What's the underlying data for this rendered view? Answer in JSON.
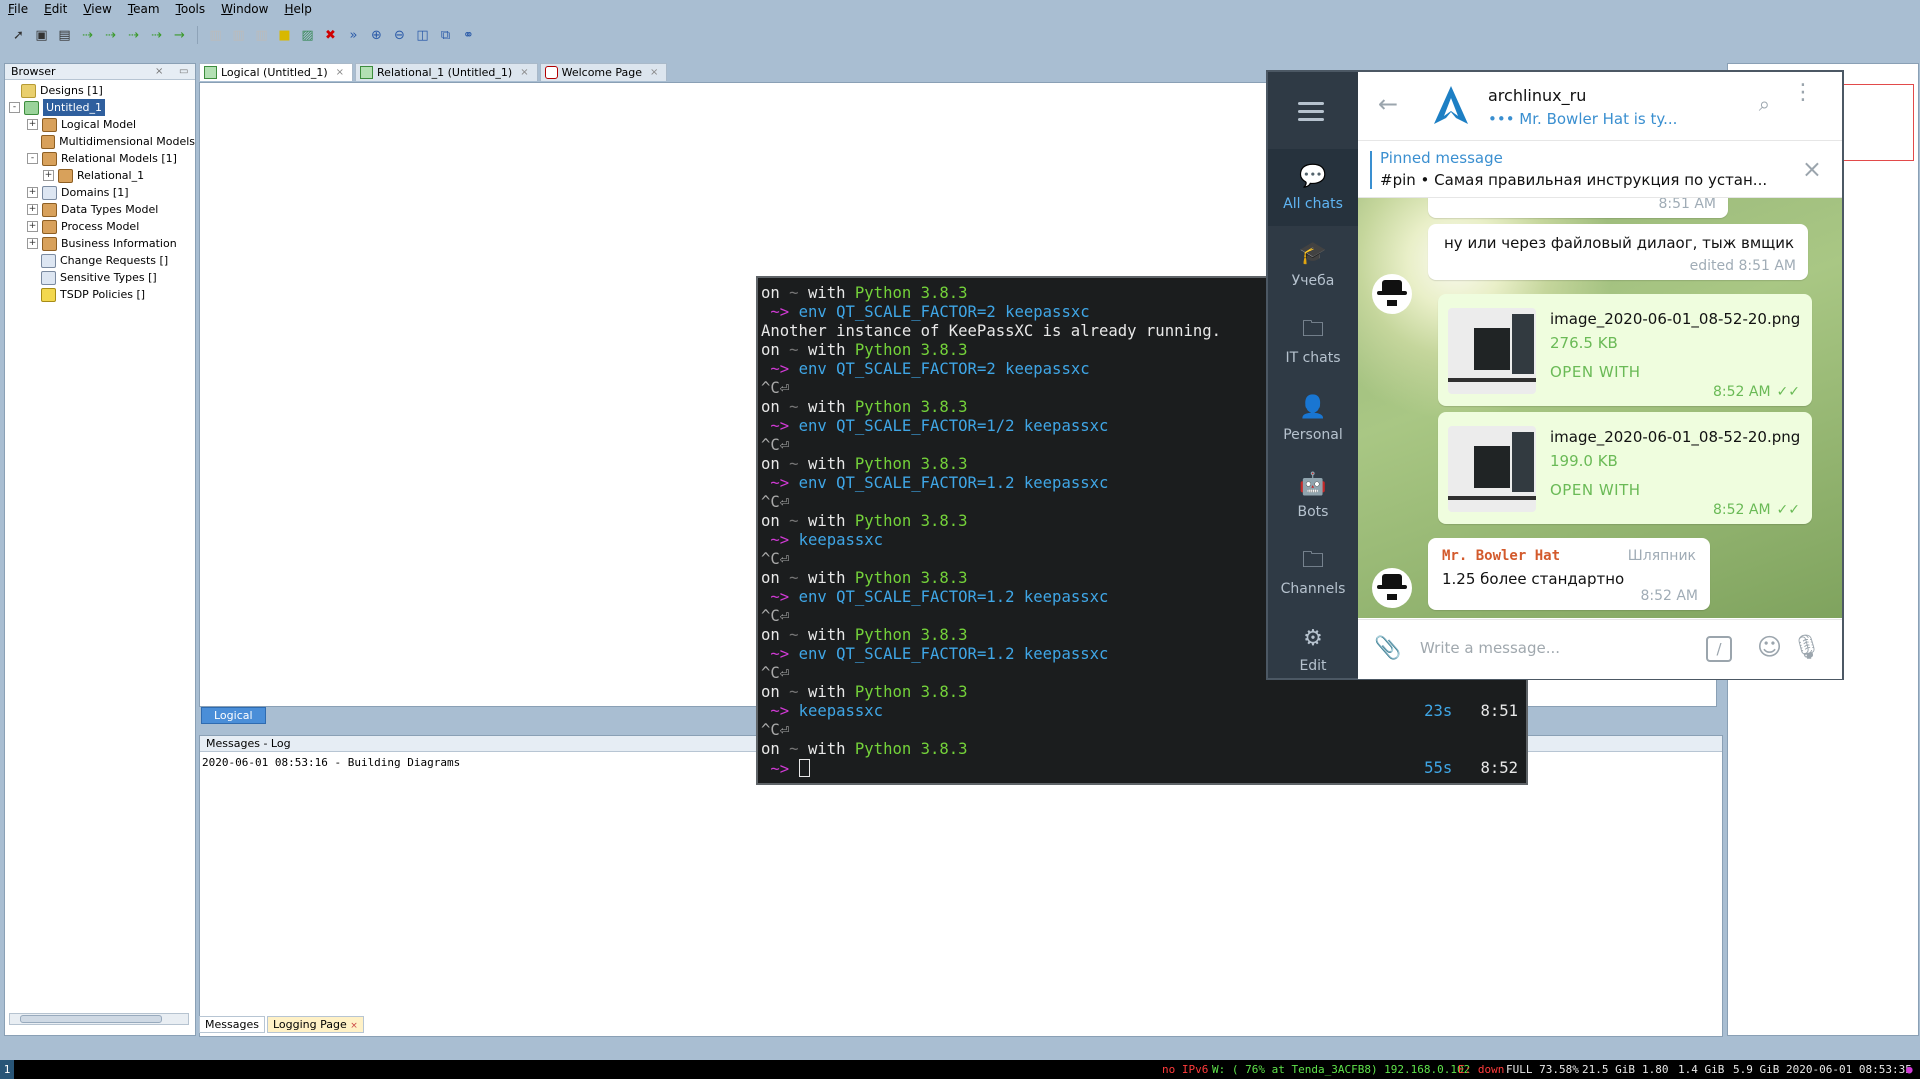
{
  "menubar": [
    "File",
    "Edit",
    "View",
    "Team",
    "Tools",
    "Window",
    "Help"
  ],
  "toolbar_icons": [
    "pointer-icon",
    "entity-icon",
    "view-icon",
    "relation-1n-icon",
    "relation-11-icon",
    "relation-nm-icon",
    "relation-1n-identifying-icon",
    "arrow-icon",
    "disabled-icon",
    "disabled-icon",
    "disabled-icon",
    "note-icon",
    "image-icon",
    "delete-icon",
    "forward-icon",
    "zoom-in-icon",
    "zoom-out-icon",
    "fit-icon",
    "layout-icon",
    "binoculars-icon"
  ],
  "browser": {
    "title": "Browser",
    "items": [
      {
        "label": "Designs [1]",
        "level": 0,
        "icon": "folder-icon",
        "expander": ""
      },
      {
        "label": "Untitled_1",
        "level": 1,
        "icon": "design-icon",
        "expander": "-",
        "selected": true
      },
      {
        "label": "Logical Model",
        "level": 2,
        "icon": "model-icon",
        "expander": "+"
      },
      {
        "label": "Multidimensional Models",
        "level": 2,
        "icon": "model-icon",
        "expander": ""
      },
      {
        "label": "Relational Models [1]",
        "level": 2,
        "icon": "model-icon",
        "expander": "-"
      },
      {
        "label": "Relational_1",
        "level": 3,
        "icon": "model-icon",
        "expander": "+"
      },
      {
        "label": "Domains [1]",
        "level": 2,
        "icon": "domain-icon",
        "expander": "+"
      },
      {
        "label": "Data Types Model",
        "level": 2,
        "icon": "model-icon",
        "expander": "+"
      },
      {
        "label": "Process Model",
        "level": 2,
        "icon": "model-icon",
        "expander": "+"
      },
      {
        "label": "Business Information",
        "level": 2,
        "icon": "model-icon",
        "expander": "+"
      },
      {
        "label": "Change Requests []",
        "level": 2,
        "icon": "doc-icon",
        "expander": ""
      },
      {
        "label": "Sensitive Types []",
        "level": 2,
        "icon": "doc-icon",
        "expander": ""
      },
      {
        "label": "TSDP Policies []",
        "level": 2,
        "icon": "lock-icon",
        "expander": ""
      }
    ]
  },
  "editor_tabs": [
    {
      "label": "Logical (Untitled_1)",
      "active": true
    },
    {
      "label": "Relational_1 (Untitled_1)",
      "active": false
    },
    {
      "label": "Welcome Page",
      "active": false
    }
  ],
  "diagram_tab": "Logical",
  "messages": {
    "title": "Messages - Log",
    "log": "2020-06-01 08:53:16 - Building Diagrams",
    "tabs": [
      "Messages",
      "Logging Page"
    ]
  },
  "terminal": {
    "lines": [
      {
        "type": "prompt",
        "on": "on",
        "tilde": "~",
        "with": "with",
        "py": "Python 3.8.3"
      },
      {
        "type": "cmd",
        "arrow": "~>",
        "env": "env",
        "cmd": "QT_SCALE_FACTOR=2 keepassxc"
      },
      {
        "type": "out",
        "text": "Another instance of KeePassXC is already running."
      },
      {
        "type": "prompt",
        "on": "on",
        "tilde": "~",
        "with": "with",
        "py": "Python 3.8.3"
      },
      {
        "type": "cmd",
        "arrow": "~>",
        "env": "env",
        "cmd": "QT_SCALE_FACTOR=2 keepassxc"
      },
      {
        "type": "ctl",
        "text": "^C⏎"
      },
      {
        "type": "prompt",
        "on": "on",
        "tilde": "~",
        "with": "with",
        "py": "Python 3.8.3"
      },
      {
        "type": "cmd",
        "arrow": "~>",
        "env": "env",
        "cmd": "QT_SCALE_FACTOR=1/2 keepassxc"
      },
      {
        "type": "ctl",
        "text": "^C⏎"
      },
      {
        "type": "prompt",
        "on": "on",
        "tilde": "~",
        "with": "with",
        "py": "Python 3.8.3"
      },
      {
        "type": "cmd",
        "arrow": "~>",
        "env": "env",
        "cmd": "QT_SCALE_FACTOR=1.2 keepassxc"
      },
      {
        "type": "ctl",
        "text": "^C⏎"
      },
      {
        "type": "prompt",
        "on": "on",
        "tilde": "~",
        "with": "with",
        "py": "Python 3.8.3"
      },
      {
        "type": "cmd",
        "arrow": "~>",
        "env": "",
        "cmd": "keepassxc"
      },
      {
        "type": "ctl",
        "text": "^C⏎"
      },
      {
        "type": "prompt",
        "on": "on",
        "tilde": "~",
        "with": "with",
        "py": "Python 3.8.3"
      },
      {
        "type": "cmd",
        "arrow": "~>",
        "env": "env",
        "cmd": "QT_SCALE_FACTOR=1.2 keepassxc"
      },
      {
        "type": "ctl",
        "text": "^C⏎"
      },
      {
        "type": "prompt",
        "on": "on",
        "tilde": "~",
        "with": "with",
        "py": "Python 3.8.3"
      },
      {
        "type": "cmd",
        "arrow": "~>",
        "env": "env",
        "cmd": "QT_SCALE_FACTOR=1.2 keepassxc"
      },
      {
        "type": "ctl",
        "text": "^C⏎"
      },
      {
        "type": "prompt",
        "on": "on",
        "tilde": "~",
        "with": "with",
        "py": "Python 3.8.3"
      },
      {
        "type": "cmd",
        "arrow": "~>",
        "env": "",
        "cmd": "keepassxc",
        "dur": "23s",
        "time": "8:51"
      },
      {
        "type": "ctl",
        "text": "^C⏎"
      },
      {
        "type": "prompt",
        "on": "on",
        "tilde": "~",
        "with": "with",
        "py": "Python 3.8.3"
      },
      {
        "type": "cursor",
        "arrow": "~>",
        "dur": "55s",
        "time": "8:52"
      }
    ]
  },
  "telegram": {
    "nav": [
      {
        "label": "All chats",
        "icon": "chat-bubbles-icon",
        "active": true
      },
      {
        "label": "Учеба",
        "icon": "graduation-cap-icon"
      },
      {
        "label": "IT chats",
        "icon": "folder-icon"
      },
      {
        "label": "Personal",
        "icon": "person-icon"
      },
      {
        "label": "Bots",
        "icon": "bot-icon"
      },
      {
        "label": "Channels",
        "icon": "folder-icon"
      },
      {
        "label": "Edit",
        "icon": "sliders-icon"
      }
    ],
    "chat_title": "archlinux_ru",
    "typing": "••• Mr. Bowler Hat is ty...",
    "pinned_label": "Pinned message",
    "pinned_text": "#pin • Самая правильная инструкция по устан...",
    "messages": {
      "m0_time": "8:51 AM",
      "m1_text": "ну или через файловый дилаог, тыж вмщик",
      "m1_time": "edited 8:51 AM",
      "f1_name": "image_2020-06-01_08-52-20.png",
      "f1_size": "276.5 KB",
      "f1_action": "OPEN WITH",
      "f1_time": "8:52 AM",
      "f2_name": "image_2020-06-01_08-52-20.png",
      "f2_size": "199.0 KB",
      "f2_action": "OPEN WITH",
      "f2_time": "8:52 AM",
      "m3_sender": "Mr. Bowler Hat",
      "m3_title": "Шляпник",
      "m3_text": "1.25 более стандартно",
      "m3_time": "8:52 AM"
    },
    "input_placeholder": "Write a message..."
  },
  "statusbar": {
    "workspace": "1",
    "ipv6": "no IPv6",
    "wifi": "W: ( 76% at Tenda_3ACFB8) 192.168.0.102",
    "eth": "E: down",
    "battery": "FULL 73.58%",
    "disk": "21.5 GiB",
    "load": "1.80",
    "mem_used": "1.4 GiB",
    "mem_free": "5.9 GiB",
    "datetime": "2020-06-01 08:53:35"
  },
  "colors": {
    "desktop": "#a9bed2",
    "terminal_bg": "#1b1d1e",
    "telegram_accent": "#3a8fd0",
    "telegram_green": "#6aba56",
    "telegram_sidebar": "#2f3a45"
  }
}
